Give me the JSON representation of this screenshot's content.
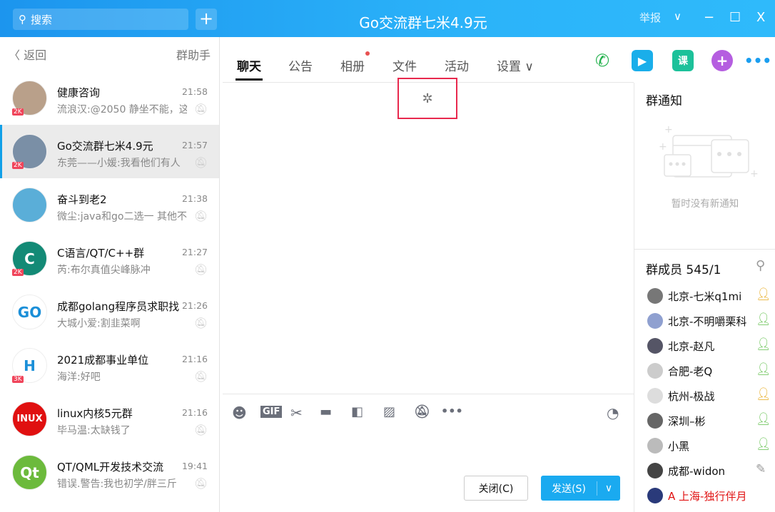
{
  "titlebar": {
    "search_placeholder": "搜索",
    "add": "+",
    "title": "Go交流群七米4.9元",
    "report": "举报",
    "dropdown": "∨",
    "minimize": "−",
    "maximize": "☐",
    "close": "X"
  },
  "sidebar": {
    "back": "返回",
    "helper": "群助手",
    "items": [
      {
        "name": "健康咨询",
        "time": "21:58",
        "msg": "流浪汉:@2050 静坐不能，这",
        "badge": "2K",
        "avatar_color": "#b9a08a",
        "avatar_text": ""
      },
      {
        "name": "Go交流群七米4.9元",
        "time": "21:57",
        "msg": "东莞——小媛:我看他们有人",
        "badge": "2K",
        "avatar_color": "#7a8fa6",
        "avatar_text": "",
        "selected": true
      },
      {
        "name": "奋斗到老2",
        "time": "21:38",
        "msg": "微尘:java和go二选一 其他不",
        "badge": "",
        "avatar_color": "#5aaed8",
        "avatar_text": ""
      },
      {
        "name": "C语言/QT/C++群",
        "time": "21:27",
        "msg": "芮:布尔真值尖峰脉冲",
        "badge": "2K",
        "avatar_color": "#138a76",
        "avatar_text": "C"
      },
      {
        "name": "成都golang程序员求职找",
        "time": "21:26",
        "msg": "大城小爱:割韭菜啊",
        "badge": "",
        "avatar_color": "#ffffff",
        "avatar_text": "GO"
      },
      {
        "name": "2021成都事业单位",
        "time": "21:16",
        "msg": "海洋:好吧",
        "badge": "3K",
        "avatar_color": "#ffffff",
        "avatar_text": "H"
      },
      {
        "name": "linux内核5元群",
        "time": "21:16",
        "msg": "毕马温:太缺钱了",
        "badge": "",
        "avatar_color": "#e01010",
        "avatar_text": "INUX"
      },
      {
        "name": "QT/QML开发技术交流",
        "time": "19:41",
        "msg": "错误.警告:我也初学/胖三斤",
        "badge": "",
        "avatar_color": "#6cba3c",
        "avatar_text": "Qt"
      }
    ]
  },
  "tabs": [
    {
      "label": "聊天"
    },
    {
      "label": "公告"
    },
    {
      "label": "相册"
    },
    {
      "label": "文件"
    },
    {
      "label": "活动"
    },
    {
      "label": "设置 ∨"
    }
  ],
  "loading_icon": "spinner",
  "toolbar_icons": [
    "emoji-icon",
    "gif-icon",
    "scissors-icon",
    "folder-icon",
    "file-icon",
    "image-icon",
    "bell-off-icon",
    "more-icon",
    "history-icon"
  ],
  "buttons": {
    "close": "关闭(C)",
    "send": "发送(S)",
    "send_menu": "∨"
  },
  "notice": {
    "title": "群通知",
    "empty": "暂时没有新通知"
  },
  "members": {
    "title": "群成员 545/1",
    "list": [
      {
        "name": "北京-七米q1mi",
        "role": "owner",
        "color": "#777"
      },
      {
        "name": "北京-不明嚼栗科",
        "role": "member",
        "color": "#8fa0d0"
      },
      {
        "name": "北京-赵凡",
        "role": "member",
        "color": "#556"
      },
      {
        "name": "合肥-老Q",
        "role": "member",
        "color": "#ccc"
      },
      {
        "name": "杭州-极战",
        "role": "admin",
        "color": "#ddd"
      },
      {
        "name": "深圳–彬",
        "role": "member",
        "color": "#666"
      },
      {
        "name": "小黑",
        "role": "member",
        "color": "#bbb"
      },
      {
        "name": "成都-widon",
        "role": "edit",
        "color": "#444"
      },
      {
        "name": "A 上海-独行伴月",
        "role": "",
        "color": "#2a3a7a",
        "highlight": "#e01010"
      }
    ]
  },
  "colors": {
    "accent": "#12a0e8",
    "titlebar": "#2bb3f9",
    "send": "#1aaaf0"
  }
}
